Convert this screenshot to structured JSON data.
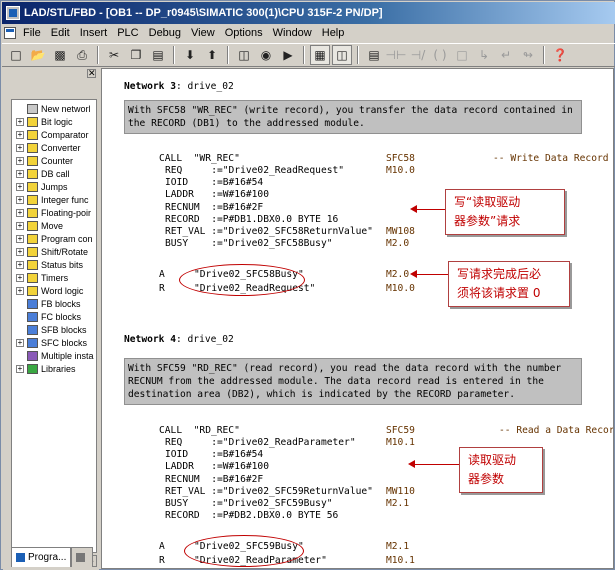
{
  "window": {
    "title": "LAD/STL/FBD  - [OB1 -- DP_r0945\\SIMATIC 300(1)\\CPU 315F-2 PN/DP]"
  },
  "menu": [
    "File",
    "Edit",
    "Insert",
    "PLC",
    "Debug",
    "View",
    "Options",
    "Window",
    "Help"
  ],
  "toolbar": {
    "icons": [
      "new-icon",
      "open-icon",
      "save-icon",
      "print-icon",
      "cut-icon",
      "copy-icon",
      "paste-icon",
      "download-icon",
      "upload-icon",
      "network-icon",
      "monitor-icon",
      "step-icon",
      "overview-icon",
      "catalog-icon",
      "contact-no-icon",
      "contact-nc-icon",
      "coil-icon",
      "box-icon",
      "branch-open-icon",
      "branch-close-icon",
      "help-icon"
    ]
  },
  "sidebar": {
    "items": [
      {
        "label": "New networl",
        "expand": false,
        "icon": "grey"
      },
      {
        "label": "Bit logic",
        "expand": true,
        "icon": "yellow"
      },
      {
        "label": "Comparator",
        "expand": true,
        "icon": "yellow"
      },
      {
        "label": "Converter",
        "expand": true,
        "icon": "yellow"
      },
      {
        "label": "Counter",
        "expand": true,
        "icon": "yellow"
      },
      {
        "label": "DB call",
        "expand": true,
        "icon": "yellow"
      },
      {
        "label": "Jumps",
        "expand": true,
        "icon": "yellow"
      },
      {
        "label": "Integer func",
        "expand": true,
        "icon": "yellow"
      },
      {
        "label": "Floating-poir",
        "expand": true,
        "icon": "yellow"
      },
      {
        "label": "Move",
        "expand": true,
        "icon": "yellow"
      },
      {
        "label": "Program con",
        "expand": true,
        "icon": "yellow"
      },
      {
        "label": "Shift/Rotate",
        "expand": true,
        "icon": "yellow"
      },
      {
        "label": "Status bits",
        "expand": true,
        "icon": "yellow"
      },
      {
        "label": "Timers",
        "expand": true,
        "icon": "yellow"
      },
      {
        "label": "Word logic",
        "expand": true,
        "icon": "yellow"
      },
      {
        "label": "FB blocks",
        "expand": false,
        "icon": "blue"
      },
      {
        "label": "FC blocks",
        "expand": false,
        "icon": "blue"
      },
      {
        "label": "SFB blocks",
        "expand": false,
        "icon": "blue"
      },
      {
        "label": "SFC blocks",
        "expand": true,
        "icon": "blue"
      },
      {
        "label": "Multiple insta",
        "expand": false,
        "icon": "purple"
      },
      {
        "label": "Libraries",
        "expand": true,
        "icon": "green"
      }
    ],
    "tabs": [
      "Progra...",
      ""
    ]
  },
  "network3": {
    "title_prefix": "Network 3",
    "title_suffix": ": drive_02",
    "comment": "With SFC58 \"WR_REC\" (write record), you transfer the data record contained in\nthe RECORD (DB1) to the addressed module.",
    "call": "CALL  \"WR_REC\"",
    "call_op": "SFC58",
    "call_comment": "-- Write Data Record",
    "params": [
      {
        "name": "REQ     :=\"Drive02_ReadRequest\"",
        "op": "M10.0"
      },
      {
        "name": "IOID    :=B#16#54",
        "op": ""
      },
      {
        "name": "LADDR   :=W#16#100",
        "op": ""
      },
      {
        "name": "RECNUM  :=B#16#2F",
        "op": ""
      },
      {
        "name": "RECORD  :=P#DB1.DBX0.0 BYTE 16",
        "op": ""
      },
      {
        "name": "RET_VAL :=\"Drive02_SFC58ReturnValue\"",
        "op": "MW108"
      },
      {
        "name": "BUSY    :=\"Drive02_SFC58Busy\"",
        "op": "M2.0"
      }
    ],
    "instr": [
      {
        "mn": "A",
        "opnd": "\"Drive02_SFC58Busy\"",
        "addr": "M2.0"
      },
      {
        "mn": "R",
        "opnd": "\"Drive02_ReadRequest\"",
        "addr": "M10.0"
      }
    ]
  },
  "network4": {
    "title_prefix": "Network 4",
    "title_suffix": ": drive_02",
    "comment": "With SFC59 \"RD_REC\" (read record), you read the data record with the number\nRECNUM from the addressed module. The data record read is entered in the\ndestination area (DB2), which is indicated by the RECORD parameter.",
    "call": "CALL  \"RD_REC\"",
    "call_op": "SFC59",
    "call_comment": "-- Read a Data Record",
    "params": [
      {
        "name": "REQ     :=\"Drive02_ReadParameter\"",
        "op": "M10.1"
      },
      {
        "name": "IOID    :=B#16#54",
        "op": ""
      },
      {
        "name": "LADDR   :=W#16#100",
        "op": ""
      },
      {
        "name": "RECNUM  :=B#16#2F",
        "op": ""
      },
      {
        "name": "RET_VAL :=\"Drive02_SFC59ReturnValue\"",
        "op": "MW110"
      },
      {
        "name": "BUSY    :=\"Drive02_SFC59Busy\"",
        "op": "M2.1"
      },
      {
        "name": "RECORD  :=P#DB2.DBX0.0 BYTE 56",
        "op": ""
      }
    ],
    "instr": [
      {
        "mn": "A",
        "opnd": "\"Drive02_SFC59Busy\"",
        "addr": "M2.1"
      },
      {
        "mn": "R",
        "opnd": "\"Drive02_ReadParameter\"",
        "addr": "M10.1"
      }
    ]
  },
  "notes": {
    "write_request": "写“读取驱动\n器参数”请求",
    "reset_request": "写请求完成后必\n须将该请求置 0",
    "read_params": "读取驱动\n器参数"
  },
  "colors": {
    "title_bar": "#0a246a",
    "annotation": "#c00000",
    "operand": "#663300",
    "comment_bg": "#c0c0c0"
  }
}
